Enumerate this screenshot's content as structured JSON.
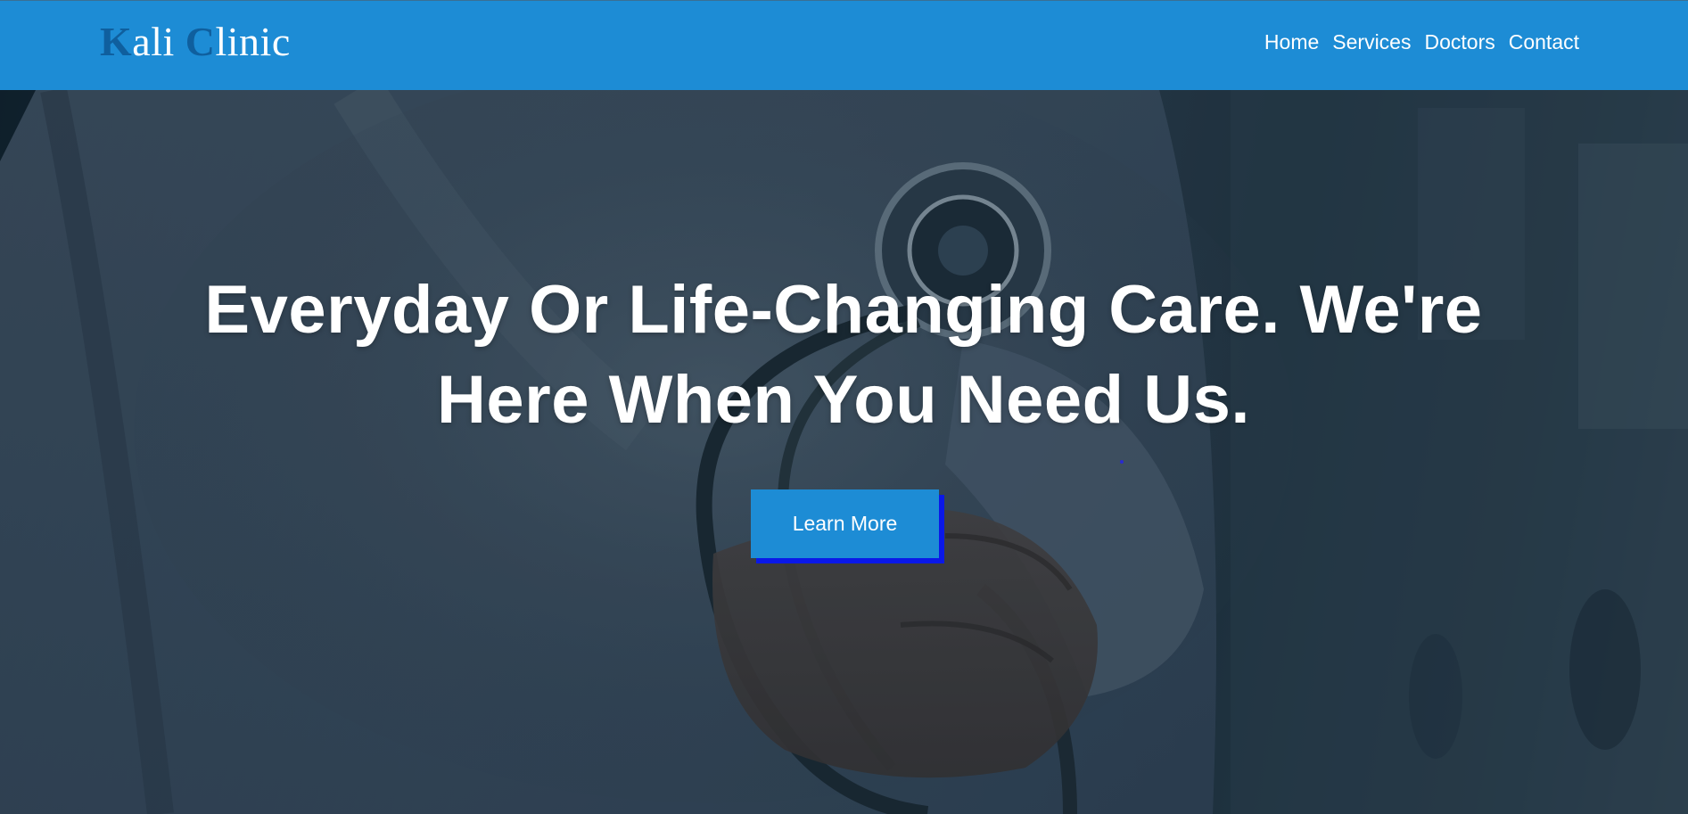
{
  "header": {
    "logo": {
      "word1_initial": "K",
      "word1_rest": "ali",
      "word2_initial": "C",
      "word2_rest": "linic"
    },
    "nav": [
      {
        "label": "Home"
      },
      {
        "label": "Services"
      },
      {
        "label": "Doctors"
      },
      {
        "label": "Contact"
      }
    ]
  },
  "hero": {
    "title_line1": "Everyday Or Life-Changing Care. We're",
    "title_line2": "Here When You Need Us.",
    "cta_label": "Learn More",
    "background_image": "doctor-with-stethoscope-photo"
  },
  "colors": {
    "brand_blue": "#1d8cd5",
    "logo_initial": "#0f5f9e",
    "button_shadow": "#0a18e8"
  }
}
